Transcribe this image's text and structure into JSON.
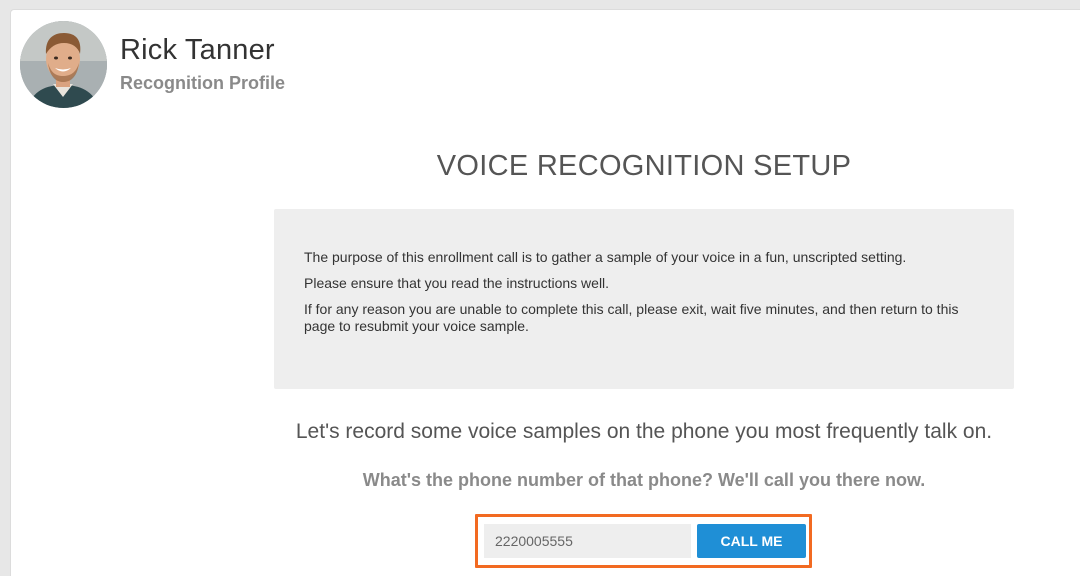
{
  "profile": {
    "name": "Rick Tanner",
    "subtitle": "Recognition Profile",
    "avatar_icon": "user-photo"
  },
  "setup": {
    "title": "VOICE RECOGNITION SETUP",
    "info": [
      "The purpose of this enrollment call is to gather a sample of your voice in a fun, unscripted setting.",
      "Please ensure that you read the instructions well.",
      "If for any reason you are unable to complete this call, please exit, wait five minutes, and then return to this page to resubmit your voice sample."
    ],
    "prompt": "Let's record some voice samples on the phone you most frequently talk on.",
    "question": "What's the phone number of that phone? We'll call you there now."
  },
  "call_form": {
    "phone_value": "2220005555",
    "button_label": "CALL ME"
  },
  "colors": {
    "accent_button": "#1f8fd6",
    "highlight_border": "#f26a21",
    "info_background": "#eeeeee"
  }
}
